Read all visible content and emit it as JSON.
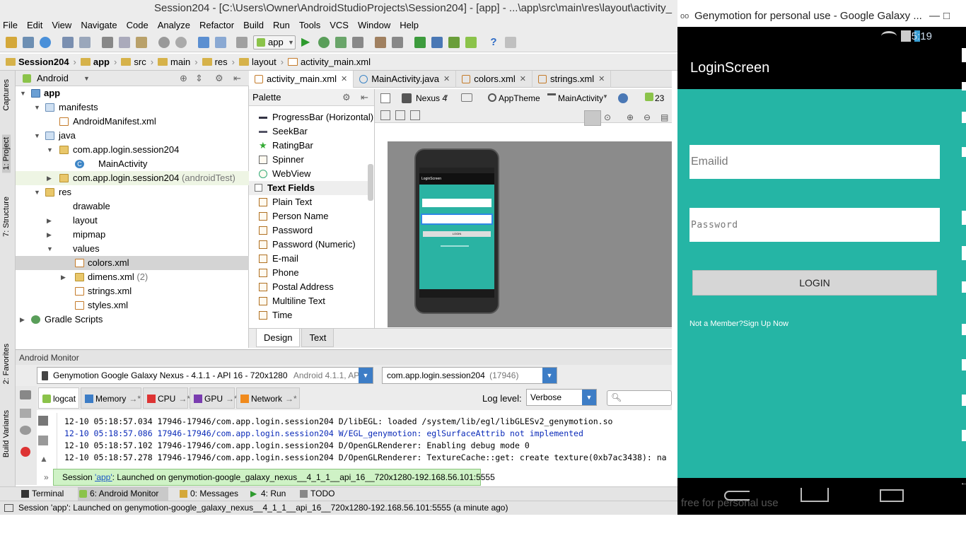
{
  "window_title": "Session204 - [C:\\Users\\Owner\\AndroidStudioProjects\\Session204] - [app] - ...\\app\\src\\main\\res\\layout\\activity_",
  "menu": [
    "File",
    "Edit",
    "View",
    "Navigate",
    "Code",
    "Analyze",
    "Refactor",
    "Build",
    "Run",
    "Tools",
    "VCS",
    "Window",
    "Help"
  ],
  "toolbar": {
    "run_config": "app"
  },
  "breadcrumb": [
    "Session204",
    "app",
    "src",
    "main",
    "res",
    "layout",
    "activity_main.xml"
  ],
  "left_strip_tabs": [
    "Captures",
    "1: Project",
    "7: Structure",
    "2: Favorites",
    "Build Variants"
  ],
  "project": {
    "view_label": "Android",
    "tree": [
      {
        "label": "app",
        "extra": ""
      },
      {
        "label": "manifests",
        "extra": ""
      },
      {
        "label": "AndroidManifest.xml",
        "extra": ""
      },
      {
        "label": "java",
        "extra": ""
      },
      {
        "label": "com.app.login.session204",
        "extra": ""
      },
      {
        "label": "MainActivity",
        "extra": ""
      },
      {
        "label": "com.app.login.session204",
        "extra": "(androidTest)"
      },
      {
        "label": "res",
        "extra": ""
      },
      {
        "label": "drawable",
        "extra": ""
      },
      {
        "label": "layout",
        "extra": ""
      },
      {
        "label": "mipmap",
        "extra": ""
      },
      {
        "label": "values",
        "extra": ""
      },
      {
        "label": "colors.xml",
        "extra": ""
      },
      {
        "label": "dimens.xml",
        "extra": "(2)"
      },
      {
        "label": "strings.xml",
        "extra": ""
      },
      {
        "label": "styles.xml",
        "extra": ""
      },
      {
        "label": "Gradle Scripts",
        "extra": ""
      }
    ]
  },
  "editor_tabs": [
    "activity_main.xml",
    "MainActivity.java",
    "colors.xml",
    "strings.xml"
  ],
  "palette": {
    "title": "Palette",
    "items": [
      "ProgressBar (Horizontal)",
      "SeekBar",
      "RatingBar",
      "Spinner",
      "WebView",
      "Text Fields",
      "Plain Text",
      "Person Name",
      "Password",
      "Password (Numeric)",
      "E-mail",
      "Phone",
      "Postal Address",
      "Multiline Text",
      "Time"
    ]
  },
  "design_toolbar": {
    "device": "Nexus 4",
    "theme": "AppTheme",
    "activity": "MainActivity",
    "api": "23"
  },
  "preview": {
    "app_title": "LoginScreen",
    "login": "LOGIN"
  },
  "design_tabs": [
    "Design",
    "Text"
  ],
  "monitor": {
    "title": "Android Monitor",
    "device": "Genymotion Google Galaxy Nexus - 4.1.1 - API 16 - 720x1280",
    "device_extra": "Android 4.1.1, API 16",
    "process": "com.app.login.session204",
    "process_pid": "(17946)",
    "tabs": [
      "logcat",
      "Memory",
      "CPU",
      "GPU",
      "Network"
    ],
    "log_level_label": "Log level:",
    "log_level": "Verbose",
    "log_lines": [
      "12-10 05:18:57.034 17946-17946/com.app.login.session204 D/libEGL: loaded /system/lib/egl/libGLESv2_genymotion.so",
      "12-10 05:18:57.086 17946-17946/com.app.login.session204 W/EGL_genymotion: eglSurfaceAttrib not implemented",
      "12-10 05:18:57.102 17946-17946/com.app.login.session204 D/OpenGLRenderer: Enabling debug mode 0",
      "12-10 05:18:57.278 17946-17946/com.app.login.session204 D/OpenGLRenderer: TextureCache::get: create texture(0xb7ac3438): na"
    ]
  },
  "balloon": {
    "prefix": "Session ",
    "link": "'app'",
    "suffix": ": Launched on genymotion-google_galaxy_nexus__4_1_1__api_16__720x1280-192.168.56.101:5555"
  },
  "bottom_tools": [
    "Terminal",
    "6: Android Monitor",
    "0: Messages",
    "4: Run",
    "TODO"
  ],
  "status": "Session 'app': Launched on genymotion-google_galaxy_nexus__4_1_1__api_16__720x1280-192.168.56.101:5555 (a minute ago)",
  "genymotion": {
    "title": "Genymotion for personal use - Google Galaxy ...",
    "time": "5:19",
    "app_title": "LoginScreen",
    "email_placeholder": "Emailid",
    "password_placeholder": "Password",
    "login_button": "LOGIN",
    "signup_link": "Not a Member?Sign Up Now",
    "watermark": "free for personal use"
  },
  "colors": {
    "accent_teal": "#25b5a5",
    "logcat_warn": "#0a2ab8",
    "balloon_bg": "#cff2c6"
  }
}
